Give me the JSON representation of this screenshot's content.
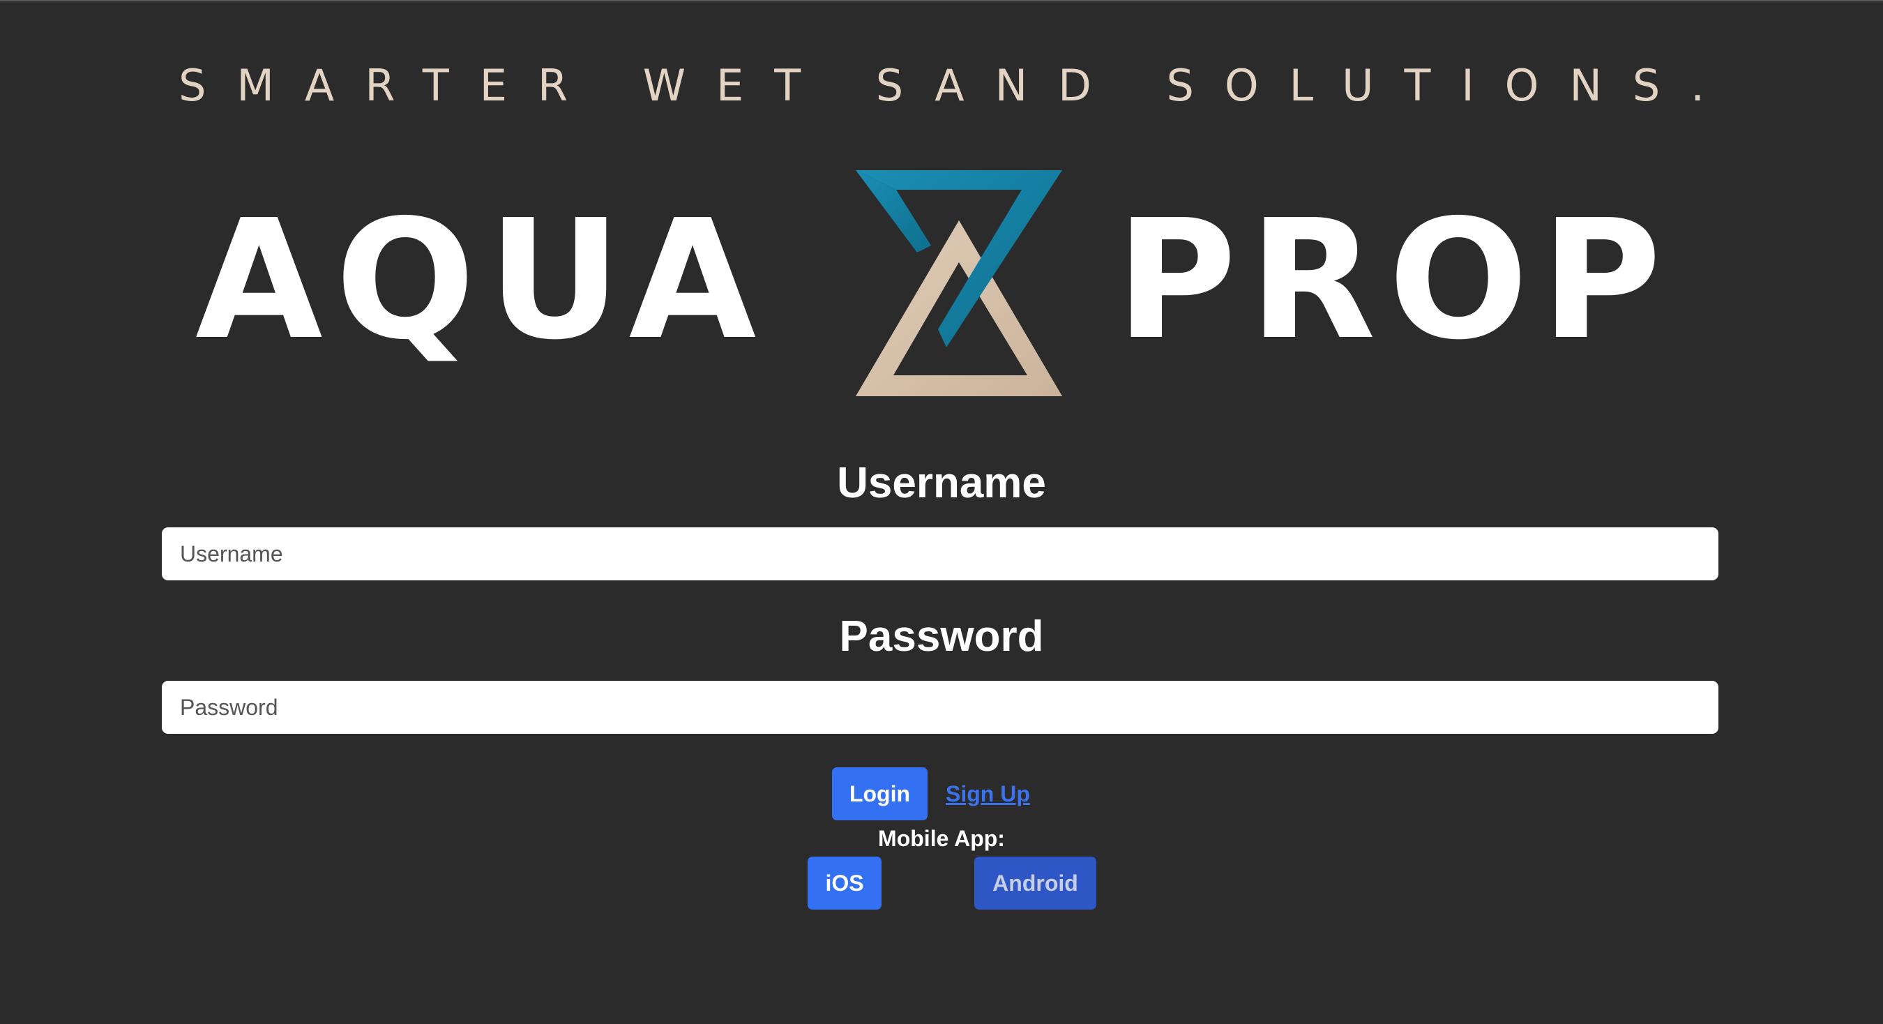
{
  "brand": {
    "tagline": "SMARTER WET SAND SOLUTIONS.",
    "logo_left": "AQUA",
    "logo_right": "PROP",
    "colors": {
      "background": "#2b2b2c",
      "tagline": "#e2d3c2",
      "logo_teal": "#1585a8",
      "logo_sand": "#d8c3ad"
    }
  },
  "form": {
    "username_label": "Username",
    "username_placeholder": "Username",
    "username_value": "",
    "password_label": "Password",
    "password_placeholder": "Password",
    "password_value": "",
    "login_label": "Login",
    "signup_label": "Sign Up"
  },
  "mobile": {
    "label": "Mobile App:",
    "ios_label": "iOS",
    "android_label": "Android"
  },
  "accent": "#3371f2"
}
